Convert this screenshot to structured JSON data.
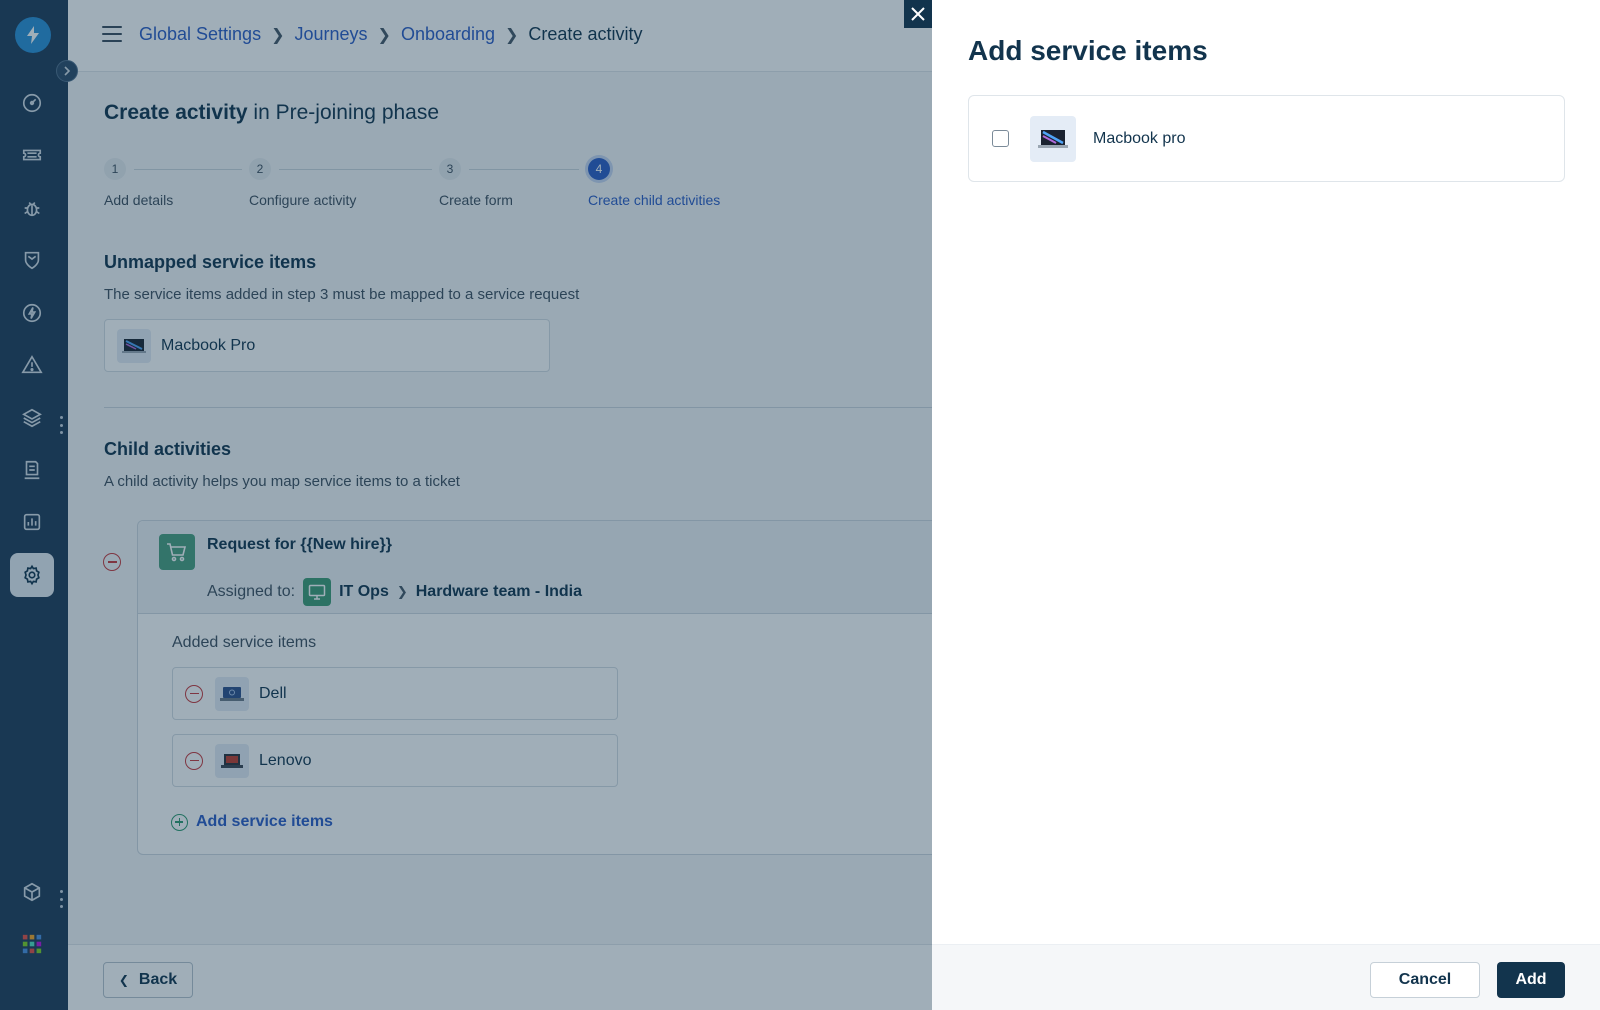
{
  "breadcrumb": {
    "items": [
      "Global Settings",
      "Journeys",
      "Onboarding"
    ],
    "current": "Create activity"
  },
  "page": {
    "title_bold": "Create activity",
    "title_rest": "in Pre-joining phase"
  },
  "stepper": {
    "steps": [
      {
        "number": "1",
        "label": "Add details"
      },
      {
        "number": "2",
        "label": "Configure activity"
      },
      {
        "number": "3",
        "label": "Create form"
      },
      {
        "number": "4",
        "label": "Create child activities"
      }
    ],
    "current_step": 4
  },
  "unmapped": {
    "title": "Unmapped service items",
    "description": "The service items added in step 3 must be mapped to a service request",
    "item": "Macbook Pro"
  },
  "child": {
    "title": "Child activities",
    "description": "A child activity helps you map service items to a ticket",
    "request_title": "Request for {{New hire}}",
    "assigned_label": "Assigned to:",
    "group": "IT Ops",
    "team": "Hardware team - India",
    "added_label": "Added service items",
    "items": [
      "Dell",
      "Lenovo"
    ],
    "add_link": "Add service items"
  },
  "footer": {
    "back": "Back"
  },
  "panel": {
    "title": "Add service items",
    "item": "Macbook pro",
    "item_checked": false,
    "cancel": "Cancel",
    "add": "Add"
  },
  "colors": {
    "nav_bg": "#1f3b57",
    "link": "#2c5cc5",
    "primary_button": "#12344d",
    "danger": "#c8383b",
    "success": "#2e9a6e"
  },
  "icons": {
    "nav": [
      "dashboard-icon",
      "ticket-icon",
      "bug-icon",
      "shield-icon",
      "bolt-icon",
      "alert-icon",
      "layers-icon",
      "document-icon",
      "report-icon",
      "settings-icon",
      "cube-icon",
      "apps-grid-icon"
    ]
  }
}
